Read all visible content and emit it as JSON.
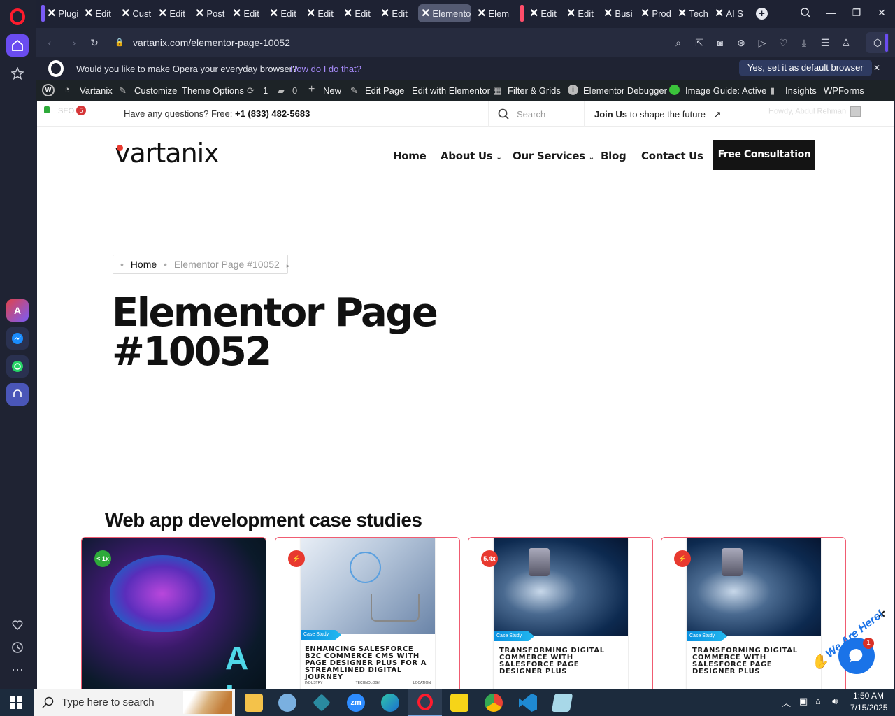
{
  "tabs": [
    {
      "label": "Plugi"
    },
    {
      "label": "Edit"
    },
    {
      "label": "Cust"
    },
    {
      "label": "Edit"
    },
    {
      "label": "Post"
    },
    {
      "label": "Edit"
    },
    {
      "label": "Edit"
    },
    {
      "label": "Edit"
    },
    {
      "label": "Edit"
    },
    {
      "label": "Edit"
    },
    {
      "label": "Elementor",
      "active": true
    },
    {
      "label": "Elem"
    },
    {
      "label": "Edit"
    },
    {
      "label": "Edit"
    },
    {
      "label": "Busi"
    },
    {
      "label": "Prod"
    },
    {
      "label": "Tech"
    },
    {
      "label": "AI S"
    }
  ],
  "address": {
    "url": "vartanix.com/elementor-page-10052"
  },
  "infobar": {
    "question": "Would you like to make Opera your everyday browser?",
    "link": "How do I do that?",
    "button": "Yes, set it as default browser"
  },
  "wpbar": {
    "site": "Vartanix",
    "customize": "Customize",
    "theme_options": "Theme Options",
    "updates": "1",
    "comments": "0",
    "new": "New",
    "edit_page": "Edit Page",
    "edit_elementor": "Edit with Elementor",
    "filter_grids": "Filter & Grids",
    "debugger": "Elementor Debugger",
    "image_guide": "Image Guide: Active",
    "insights": "Insights",
    "wpforms": "WPForms"
  },
  "topstrip": {
    "seo": "SEO",
    "seo_count": "5",
    "question": "Have any questions? Free:",
    "phone": "+1 (833) 482-5683",
    "search_placeholder": "Search",
    "join_bold": "Join Us",
    "join_rest": "to shape the future",
    "howdy": "Howdy, Abdul Rehman"
  },
  "header": {
    "logo": "vartanix",
    "nav": [
      "Home",
      "About Us",
      "Our Services",
      "Blog",
      "Contact Us"
    ],
    "cta": "Free Consultation"
  },
  "breadcrumb": {
    "home": "Home",
    "current": "Elementor Page #10052"
  },
  "hero": {
    "title_line1": "Elementor Page",
    "title_line2": "#10052"
  },
  "section": {
    "title": "Web app development case studies"
  },
  "cards": [
    {
      "badge": "< 1x",
      "badge_color": "#2eaa3a",
      "overlay_text": "A I"
    },
    {
      "badge": "⚡",
      "badge_color": "#e8392f",
      "tag": "Case Study",
      "title": "ENHANCING SALESFORCE B2C COMMERCE CMS WITH PAGE DESIGNER PLUS FOR A STREAMLINED DIGITAL JOURNEY",
      "foot1": "INDUSTRY",
      "foot2": "TECHNOLOGY",
      "foot3": "LOCATION"
    },
    {
      "badge": "5.4x",
      "badge_color": "#e8392f",
      "tag": "Case Study",
      "title": "TRANSFORMING DIGITAL COMMERCE WITH SALESFORCE PAGE DESIGNER PLUS"
    },
    {
      "badge": "⚡",
      "badge_color": "#e8392f",
      "tag": "Case Study",
      "title": "TRANSFORMING DIGITAL COMMERCE WITH SALESFORCE PAGE DESIGNER PLUS"
    }
  ],
  "chat": {
    "count": "1",
    "label": "We Are Here!"
  },
  "taskbar": {
    "search": "Type here to search",
    "time": "1:50 AM",
    "date": "7/15/2025"
  },
  "colors": {
    "accent": "#e8392f",
    "dark": "#1a1a1a",
    "opera_red": "#ff1b2d",
    "chat_blue": "#1a73e8"
  }
}
